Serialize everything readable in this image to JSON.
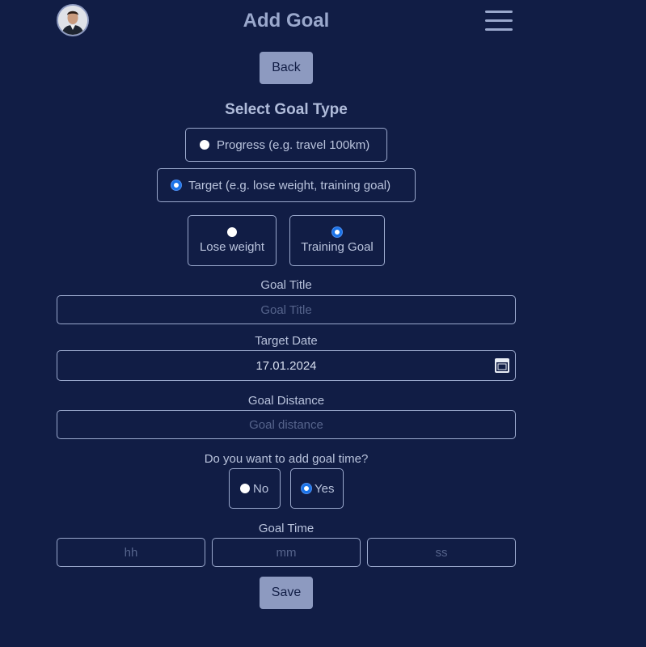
{
  "header": {
    "title": "Add Goal",
    "avatar_icon": "profile-photo",
    "menu_icon": "hamburger-menu-icon"
  },
  "back_label": "Back",
  "goal_type": {
    "heading": "Select Goal Type",
    "options": [
      {
        "label": "Progress (e.g. travel 100km)",
        "checked": false
      },
      {
        "label": "Target (e.g. lose weight, training goal)",
        "checked": true
      }
    ],
    "target_options": [
      {
        "label": "Lose weight",
        "checked": false
      },
      {
        "label": "Training Goal",
        "checked": true
      }
    ]
  },
  "goal_title": {
    "label": "Goal Title",
    "placeholder": "Goal Title",
    "value": ""
  },
  "target_date": {
    "label": "Target Date",
    "value": "17.01.2024"
  },
  "goal_distance": {
    "label": "Goal Distance",
    "placeholder": "Goal distance",
    "value": ""
  },
  "add_time": {
    "question": "Do you want to add goal time?",
    "options": [
      {
        "label": "No",
        "checked": false
      },
      {
        "label": "Yes",
        "checked": true
      }
    ]
  },
  "goal_time": {
    "label": "Goal Time",
    "hh_placeholder": "hh",
    "mm_placeholder": "mm",
    "ss_placeholder": "ss"
  },
  "save_label": "Save",
  "colors": {
    "background": "#111d45",
    "button": "#8d9ac0",
    "accent": "#1a73e8",
    "text": "#b9c3dc"
  }
}
